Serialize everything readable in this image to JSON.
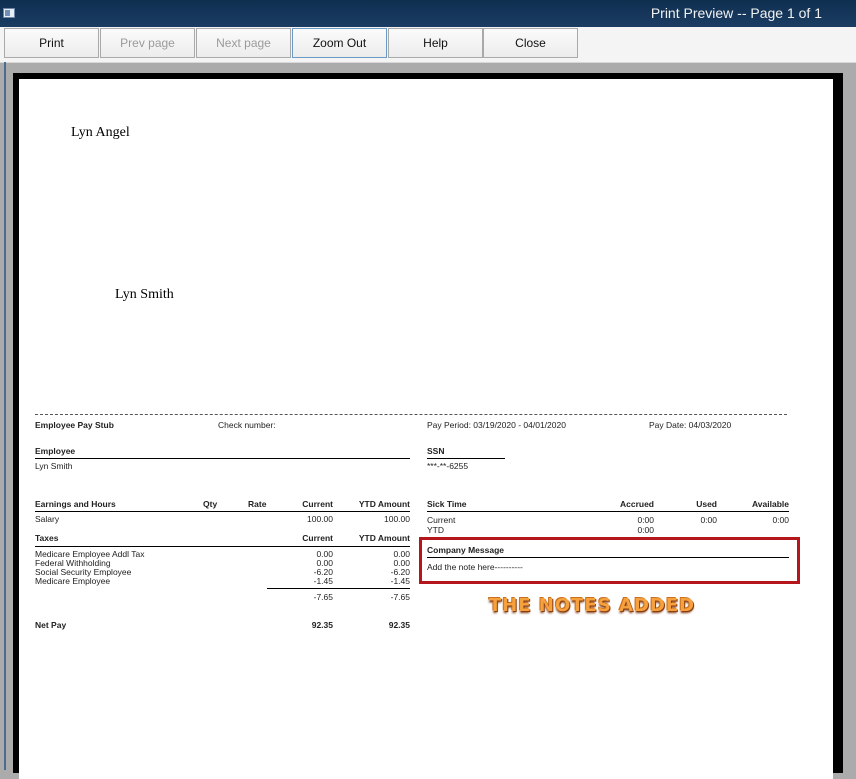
{
  "window": {
    "title": "Print Preview -- Page 1 of 1"
  },
  "toolbar": {
    "print": "Print",
    "prev": "Prev page",
    "next": "Next page",
    "zoom": "Zoom Out",
    "help": "Help",
    "close": "Close"
  },
  "check": {
    "company": "Lyn Angel",
    "payee": "Lyn Smith"
  },
  "stub": {
    "title": "Employee Pay Stub",
    "check_number_label": "Check number:",
    "pay_period": "Pay Period: 03/19/2020 - 04/01/2020",
    "pay_date": "Pay Date: 04/03/2020",
    "employee_label": "Employee",
    "employee_name": "Lyn Smith",
    "ssn_label": "SSN",
    "ssn_value": "***-**-6255",
    "earnings": {
      "headers": [
        "Earnings and Hours",
        "Qty",
        "Rate",
        "Current",
        "YTD Amount"
      ],
      "rows": [
        {
          "name": "Salary",
          "current": "100.00",
          "ytd": "100.00"
        }
      ]
    },
    "taxes": {
      "headers": [
        "Taxes",
        "Current",
        "YTD Amount"
      ],
      "rows": [
        {
          "name": "Medicare Employee Addl Tax",
          "current": "0.00",
          "ytd": "0.00"
        },
        {
          "name": "Federal Withholding",
          "current": "0.00",
          "ytd": "0.00"
        },
        {
          "name": "Social Security Employee",
          "current": "-6.20",
          "ytd": "-6.20"
        },
        {
          "name": "Medicare Employee",
          "current": "-1.45",
          "ytd": "-1.45"
        }
      ],
      "total_current": "-7.65",
      "total_ytd": "-7.65"
    },
    "net_pay": {
      "label": "Net Pay",
      "current": "92.35",
      "ytd": "92.35"
    },
    "sick": {
      "headers": [
        "Sick Time",
        "Accrued",
        "Used",
        "Available"
      ],
      "rows": [
        {
          "label": "Current",
          "accrued": "0:00",
          "used": "0:00",
          "available": "0:00"
        },
        {
          "label": "YTD",
          "accrued": "0:00"
        }
      ]
    },
    "company_message": {
      "label": "Company Message",
      "text": "Add the note here----------"
    }
  },
  "annotation": {
    "text": "THE NOTES ADDED",
    "color": "#f6a13d",
    "box_color": "#b4161b"
  }
}
